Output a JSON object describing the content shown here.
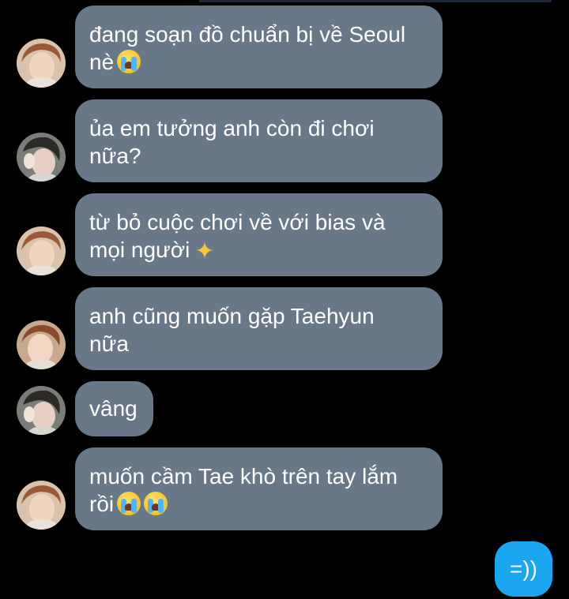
{
  "conversation": {
    "messages": [
      {
        "sender": "friend-a",
        "lines": [
          "đang soạn đồ chuẩn bị về Seoul",
          "nè"
        ],
        "emoji": "loudly-crying-face-icon"
      },
      {
        "sender": "friend-b",
        "lines": [
          "ủa em tưởng anh còn đi chơi",
          "nữa?"
        ]
      },
      {
        "sender": "friend-a",
        "lines": [
          "từ bỏ cuộc chơi về với bias và",
          "mọi người"
        ],
        "emoji": "sparkles-icon"
      },
      {
        "sender": "friend-a",
        "lines": [
          "anh cũng muốn gặp Taehyun",
          "nữa"
        ]
      },
      {
        "sender": "friend-b",
        "lines": [
          "vâng"
        ]
      },
      {
        "sender": "friend-a",
        "lines": [
          "muốn cầm Tae khò trên tay lắm",
          "rồi"
        ],
        "emoji": "loudly-crying-face-icon",
        "emoji_count": 2
      }
    ],
    "sent_message": "=))"
  },
  "colors": {
    "background": "#000000",
    "received_bubble": "#687888",
    "sent_bubble": "#1aa6f0",
    "text": "#ffffff"
  }
}
